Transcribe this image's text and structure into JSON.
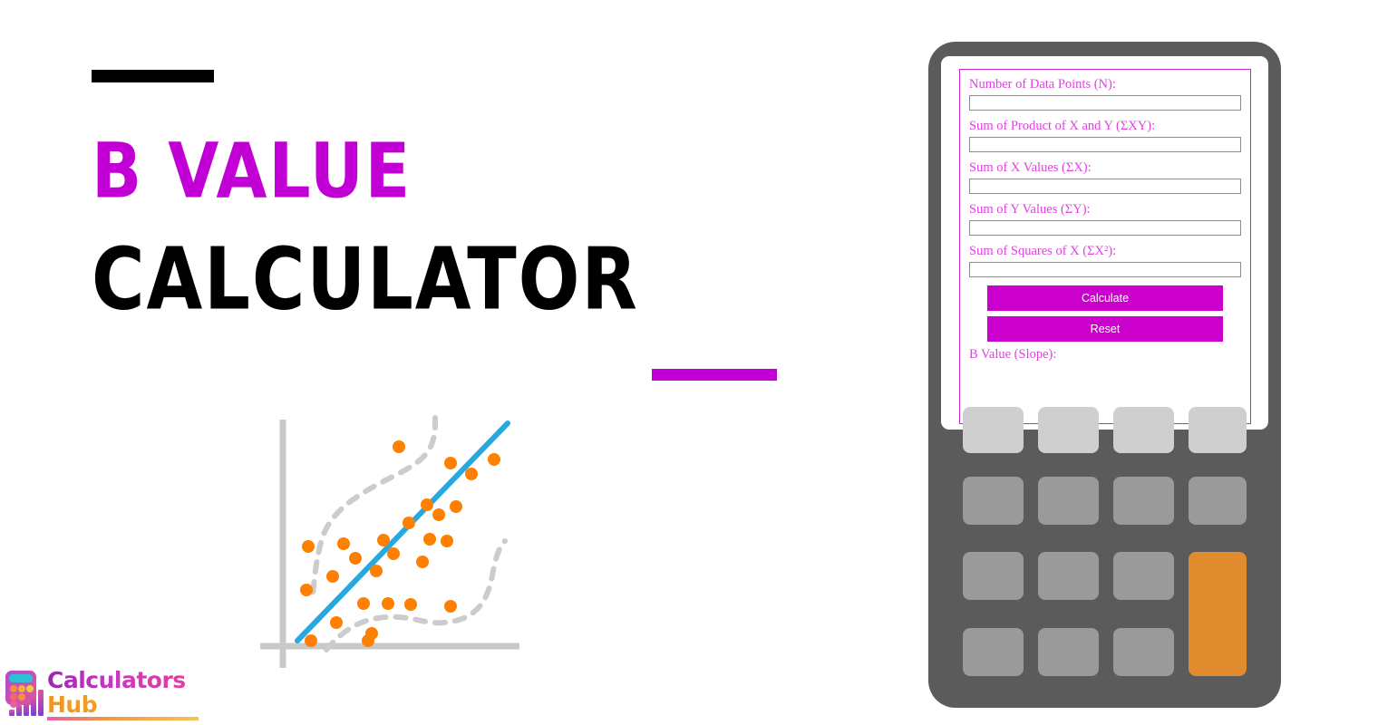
{
  "page": {
    "background": "#ffffff",
    "accent_magenta": "#c200d6",
    "accent_black": "#000000"
  },
  "hero": {
    "title_line1": "B VALUE",
    "title_line2": "CALCULATOR",
    "rule_top_color": "#000000",
    "rule_bottom_color": "#c200d6"
  },
  "logo": {
    "word1": "Calculators",
    "word2": "Hub",
    "word1_color": "#c936c4",
    "word2_color": "#f0941f",
    "mark": "calculator-bars-icon"
  },
  "chart_data": {
    "type": "scatter",
    "title": "",
    "xlabel": "",
    "ylabel": "",
    "grid": false,
    "legend": null,
    "xlim": [
      0,
      100
    ],
    "ylim": [
      0,
      100
    ],
    "axis_color": "#c8c8c8",
    "point_color": "#ff8000",
    "point_radius": 6,
    "trendline": {
      "name": "Regression line (B value / slope)",
      "color": "#29a8e0",
      "x": [
        5,
        97
      ],
      "y": [
        4,
        96
      ],
      "width": 5
    },
    "envelope": {
      "name": "Confidence band",
      "color": "#cccccc",
      "style": "dashed"
    },
    "points": [
      {
        "x": 15,
        "y": 46
      },
      {
        "x": 11,
        "y": 27
      },
      {
        "x": 27,
        "y": 47
      },
      {
        "x": 22,
        "y": 33
      },
      {
        "x": 33,
        "y": 41
      },
      {
        "x": 36,
        "y": 21
      },
      {
        "x": 24,
        "y": 13
      },
      {
        "x": 13,
        "y": 4
      },
      {
        "x": 39,
        "y": 8
      },
      {
        "x": 37,
        "y": 4
      },
      {
        "x": 44,
        "y": 49
      },
      {
        "x": 41,
        "y": 36
      },
      {
        "x": 48,
        "y": 43
      },
      {
        "x": 46,
        "y": 21
      },
      {
        "x": 51,
        "y": 89
      },
      {
        "x": 55,
        "y": 58
      },
      {
        "x": 56,
        "y": 21
      },
      {
        "x": 62,
        "y": 66
      },
      {
        "x": 63,
        "y": 51
      },
      {
        "x": 60,
        "y": 41
      },
      {
        "x": 67,
        "y": 62
      },
      {
        "x": 70,
        "y": 45
      },
      {
        "x": 72,
        "y": 82
      },
      {
        "x": 74,
        "y": 65
      },
      {
        "x": 72,
        "y": 20
      },
      {
        "x": 80,
        "y": 77
      },
      {
        "x": 88,
        "y": 83
      }
    ]
  },
  "device": {
    "frame_color": "#5b5b5b",
    "screen_color": "#ffffff",
    "form": {
      "border_color": "#cc22cc",
      "fields": [
        {
          "label": "Number of Data Points (N):",
          "value": "",
          "placeholder": ""
        },
        {
          "label": "Sum of Product of X and Y (ΣXY):",
          "value": "",
          "placeholder": ""
        },
        {
          "label": "Sum of X Values (ΣX):",
          "value": "",
          "placeholder": ""
        },
        {
          "label": "Sum of Y Values (ΣY):",
          "value": "",
          "placeholder": ""
        },
        {
          "label": "Sum of Squares of X (ΣX²):",
          "value": "",
          "placeholder": ""
        }
      ],
      "calculate_label": "Calculate",
      "reset_label": "Reset",
      "result_label": "B Value (Slope):",
      "button_color": "#cc00cc",
      "label_color": "#e040e0"
    },
    "keypad": {
      "rows": 4,
      "cols": 4,
      "key_color": "#9a9a9a",
      "key_light_color": "#cfcfcf",
      "accent_key_color": "#e08b2e",
      "accent_key_name": "equals-key"
    }
  }
}
